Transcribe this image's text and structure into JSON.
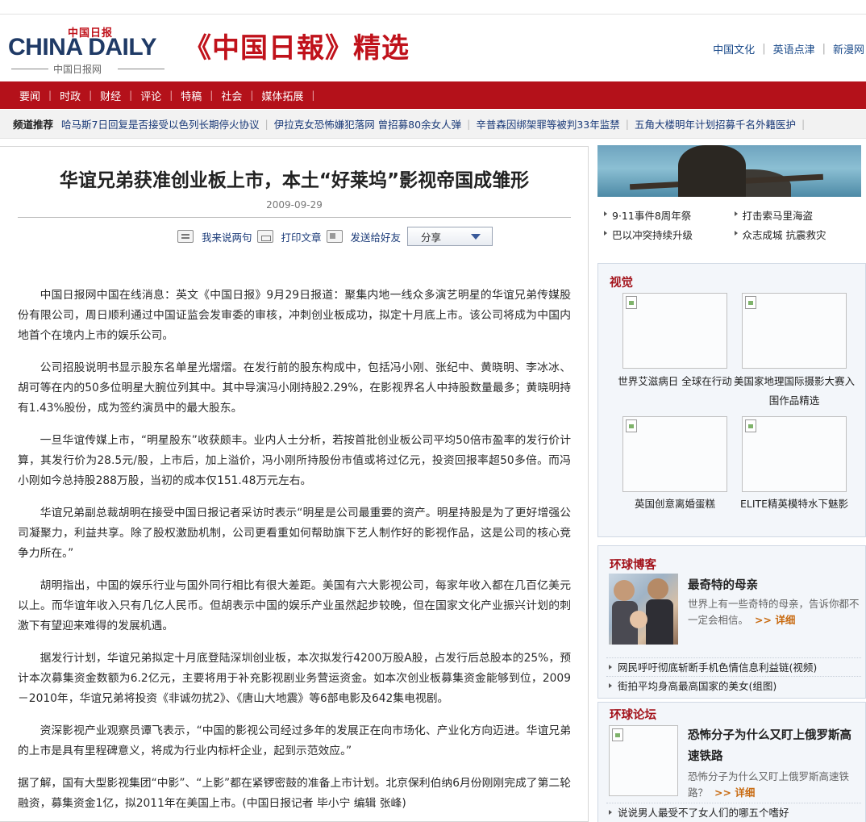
{
  "header": {
    "logo_cn_top": "中国日报",
    "logo_en": "CHINA DAILY",
    "logo_cn_bottom": "中国日报网",
    "brand_title": "《中国日報》精选",
    "top_links": [
      "中国文化",
      "英语点津",
      "新漫网"
    ]
  },
  "nav": {
    "items": [
      "要闻",
      "时政",
      "财经",
      "评论",
      "特稿",
      "社会",
      "媒体拓展"
    ]
  },
  "channel": {
    "title": "频道推荐",
    "links": [
      "哈马斯7日回复是否接受以色列长期停火协议",
      "伊拉克女恐怖嫌犯落网 曾招募80余女人弹",
      "辛普森因绑架罪等被判33年监禁",
      "五角大楼明年计划招募千名外籍医护"
    ]
  },
  "article": {
    "title": "华谊兄弟获准创业板上市，本土“好莱坞”影视帝国成雏形",
    "date": "2009-09-29",
    "tools": {
      "comment": "我来说两句",
      "print": "打印文章",
      "send": "发送给好友",
      "share": "分享"
    },
    "paragraphs": [
      "中国日报网中国在线消息：英文《中国日报》9月29日报道：聚集内地一线众多演艺明星的华谊兄弟传媒股份有限公司，周日顺利通过中国证监会发审委的审核，冲刺创业板成功，拟定十月底上市。该公司将成为中国内地首个在境内上市的娱乐公司。",
      "公司招股说明书显示股东名单星光熠熠。在发行前的股东构成中，包括冯小刚、张纪中、黄晓明、李冰冰、胡可等在内的50多位明星大腕位列其中。其中导演冯小刚持股2.29%，在影视界名人中持股数量最多；黄晓明持有1.43%股份，成为签约演员中的最大股东。",
      "一旦华谊传媒上市，“明星股东”收获颇丰。业内人士分析，若按首批创业板公司平均50倍市盈率的发行价计算，其发行价为28.5元/股，上市后，加上溢价，冯小刚所持股份市值或将过亿元，投资回报率超50多倍。而冯小刚如今总持股288万股，当初的成本仅151.48万元左右。",
      "华谊兄弟副总裁胡明在接受中国日报记者采访时表示“明星是公司最重要的资产。明星持股是为了更好增强公司凝聚力，利益共享。除了股权激励机制，公司更看重如何帮助旗下艺人制作好的影视作品，这是公司的核心竞争力所在。”",
      "胡明指出，中国的娱乐行业与国外同行相比有很大差距。美国有六大影视公司，每家年收入都在几百亿美元以上。而华谊年收入只有几亿人民币。但胡表示中国的娱乐产业虽然起步较晚，但在国家文化产业振兴计划的刺激下有望迎来难得的发展机遇。",
      "据发行计划，华谊兄弟拟定十月底登陆深圳创业板，本次拟发行4200万股A股，占发行后总股本的25%，预计本次募集资金数额为6.2亿元，主要将用于补充影视剧业务营运资金。如本次创业板募集资金能够到位，2009－2010年，华谊兄弟将投资《非诚勿扰2》、《唐山大地震》等6部电影及642集电视剧。",
      "资深影视产业观察员谭飞表示，“中国的影视公司经过多年的发展正在向市场化、产业化方向迈进。华谊兄弟的上市是具有里程碑意义，将成为行业内标杆企业，起到示范效应。”",
      "据了解，国有大型影视集团“中影”、“上影”都在紧锣密鼓的准备上市计划。北京保利伯纳6月份刚刚完成了第二轮融资，募集资金1亿，拟2011年在美国上市。(中国日报记者 毕小宁  编辑  张峰)"
    ]
  },
  "sidebar": {
    "hot_links": [
      "9·11事件8周年祭",
      "打击索马里海盗",
      "巴以冲突持续升级",
      "众志成城 抗震救灾"
    ],
    "visual": {
      "title": "视觉",
      "items": [
        "世界艾滋病日 全球在行动",
        "美国家地理国际摄影大赛入围作品精选",
        "英国创意离婚蛋糕",
        "ELITE精英模特水下魅影"
      ]
    },
    "blog": {
      "title": "环球博客",
      "feature_title": "最奇特的母亲",
      "feature_desc": "世界上有一些奇特的母亲，告诉你都不一定会相信。",
      "more": ">> 详细",
      "links": [
        "网民呼吁彻底斩断手机色情信息利益链(视频)",
        "街拍平均身高最高国家的美女(组图)"
      ]
    },
    "forum": {
      "title": "环球论坛",
      "feature_title": "恐怖分子为什么又盯上俄罗斯高速铁路",
      "feature_desc": "恐怖分子为什么又盯上俄罗斯高速铁路？",
      "more": ">> 详细",
      "links": [
        "说说男人最受不了女人们的哪五个嗜好"
      ]
    }
  }
}
